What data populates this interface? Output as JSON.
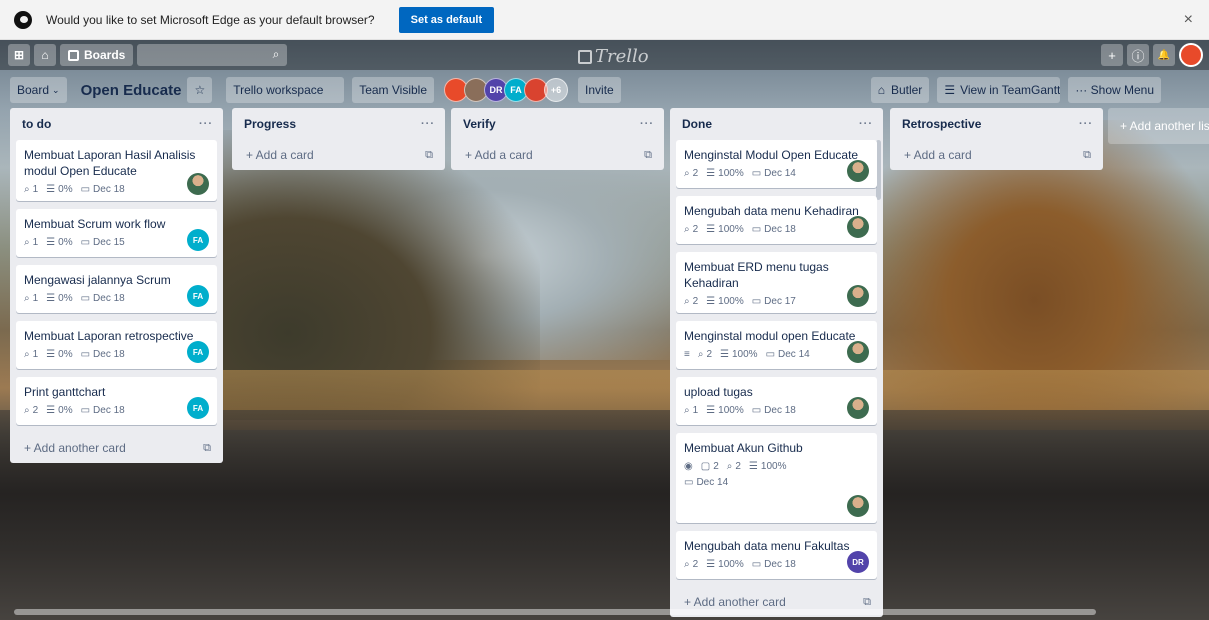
{
  "edge": {
    "message": "Would you like to set Microsoft Edge as your default browser?",
    "set_default": "Set as default",
    "close": "×"
  },
  "topbar": {
    "apps": "⊞",
    "home": "⌂",
    "boards": "Boards",
    "logo": "Trello",
    "add": "+",
    "info": "ⓘ",
    "bell": "🔔"
  },
  "board": {
    "board_btn": "Board",
    "title": "Open Educate",
    "workspace": "Trello workspace",
    "visibility": "Team Visible",
    "members_more": "+6",
    "invite": "Invite",
    "butler": "Butler",
    "teamgantt": "View in TeamGantt",
    "show_menu": "··· Show Menu",
    "add_list": "+ Add another list",
    "members": [
      {
        "initials": "",
        "color": "#e84a2a"
      },
      {
        "initials": "",
        "color": "#8a6e5a"
      },
      {
        "initials": "DR",
        "color": "#5243aa"
      },
      {
        "initials": "FA",
        "color": "#00aecc"
      },
      {
        "initials": "",
        "color": "#d9432f"
      }
    ]
  },
  "lists": [
    {
      "name": "to do",
      "add": "+ Add another card",
      "cards": [
        {
          "title": "Membuat Laporan Hasil Analisis modul Open Educate",
          "attach": "1",
          "check": "0%",
          "due": "Dec 18",
          "member": "ph"
        },
        {
          "title": "Membuat Scrum work flow",
          "attach": "1",
          "check": "0%",
          "due": "Dec 15",
          "member": "FA"
        },
        {
          "title": "Mengawasi jalannya Scrum",
          "attach": "1",
          "check": "0%",
          "due": "Dec 18",
          "member": "FA"
        },
        {
          "title": "Membuat Laporan retrospective",
          "attach": "1",
          "check": "0%",
          "due": "Dec 18",
          "member": "FA"
        },
        {
          "title": "Print ganttchart",
          "attach": "2",
          "check": "0%",
          "due": "Dec 18",
          "member": "FA"
        }
      ]
    },
    {
      "name": "Progress",
      "add": "+ Add a card",
      "cards": []
    },
    {
      "name": "Verify",
      "add": "+ Add a card",
      "cards": []
    },
    {
      "name": "Done",
      "add": "+ Add another card",
      "cards": [
        {
          "title": "Menginstal Modul Open Educate",
          "attach": "2",
          "check": "100%",
          "due": "Dec 14",
          "member": "ph"
        },
        {
          "title": "Mengubah data  menu Kehadiran",
          "attach": "2",
          "check": "100%",
          "due": "Dec 18",
          "member": "ph"
        },
        {
          "title": "Membuat ERD menu tugas Kehadiran",
          "attach": "2",
          "check": "100%",
          "due": "Dec 17",
          "member": "ph"
        },
        {
          "title": "Menginstal modul open Educate",
          "desc": "≡",
          "attach": "2",
          "check": "100%",
          "due": "Dec 14",
          "member": "ph"
        },
        {
          "title": "upload tugas",
          "attach": "1",
          "check": "100%",
          "due": "Dec 18",
          "member": "ph"
        },
        {
          "title": "Membuat  Akun Github",
          "watch": "◉",
          "comments": "2",
          "attach": "2",
          "check": "100%",
          "due": "Dec 14",
          "member": "ph"
        },
        {
          "title": "Mengubah data  menu Fakultas",
          "attach": "2",
          "check": "100%",
          "due": "Dec 18",
          "member": "DR"
        }
      ]
    },
    {
      "name": "Retrospective",
      "add": "+ Add a card",
      "cards": []
    }
  ],
  "icons": {
    "attach": "🖇",
    "checklist": "☰",
    "due": "🗓",
    "template": "⧉",
    "menu": "···"
  }
}
